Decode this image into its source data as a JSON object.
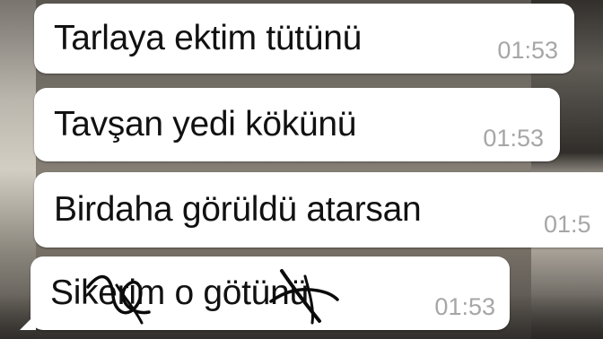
{
  "messages": [
    {
      "text": "Tarlaya ektim tütünü",
      "time": "01:53"
    },
    {
      "text": "Tavşan yedi kökünü",
      "time": "01:53"
    },
    {
      "text": "Birdaha görüldü atarsan",
      "time": "01:5"
    },
    {
      "text": "Sikerim o götünü",
      "time": "01:53"
    }
  ],
  "colors": {
    "bubble": "#ffffff",
    "text": "#111111",
    "timestamp": "#a6a6a6",
    "scribble": "#0b0b0b"
  },
  "icons": [
    "scribble-censor-icon"
  ]
}
